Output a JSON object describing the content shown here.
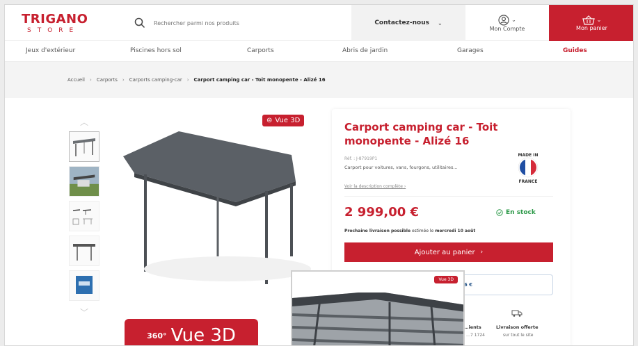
{
  "header": {
    "logo_main": "TRIGANO",
    "logo_sub": "STORE",
    "search_placeholder": "Rechercher parmi nos produits",
    "contact_label": "Contactez-nous",
    "account_label": "Mon Compte",
    "cart_label": "Mon panier"
  },
  "nav": {
    "items": [
      "Jeux d'extérieur",
      "Piscines hors sol",
      "Carports",
      "Abris de jardin",
      "Garages",
      "Guides"
    ]
  },
  "breadcrumb": {
    "items": [
      "Accueil",
      "Carports",
      "Carports camping-car",
      "Carport camping car - Toit monopente - Alizé 16"
    ]
  },
  "gallery": {
    "badge_3d": "Vue 3D",
    "big_badge_360": "360°",
    "big_badge_label": "Vue 3D"
  },
  "product": {
    "title": "Carport camping car - Toit monopente - Alizé 16",
    "ref": "Réf. : J-87919P1",
    "description": "Carport pour voitures, vans, fourgons, utilitaires...",
    "made_in_top": "MADE IN",
    "made_in_bottom": "FRANCE",
    "description_link": "Voir la description complète",
    "price": "2 999,00 €",
    "stock": "En stock",
    "delivery_prefix": "Prochaine livraison possible",
    "delivery_mid": "estimée le",
    "delivery_date": "mercredi 10 août",
    "add_to_cart": "Ajouter au panier",
    "financing_text": "36 €",
    "services": [
      {
        "label": "…ients",
        "sub": "…7 1724"
      },
      {
        "label": "Livraison offerte",
        "sub": "sur tout le site"
      }
    ]
  },
  "viewer": {
    "badge": "Vue 3D"
  },
  "colors": {
    "brand": "#c7202f",
    "stock": "#2e9a4a"
  }
}
